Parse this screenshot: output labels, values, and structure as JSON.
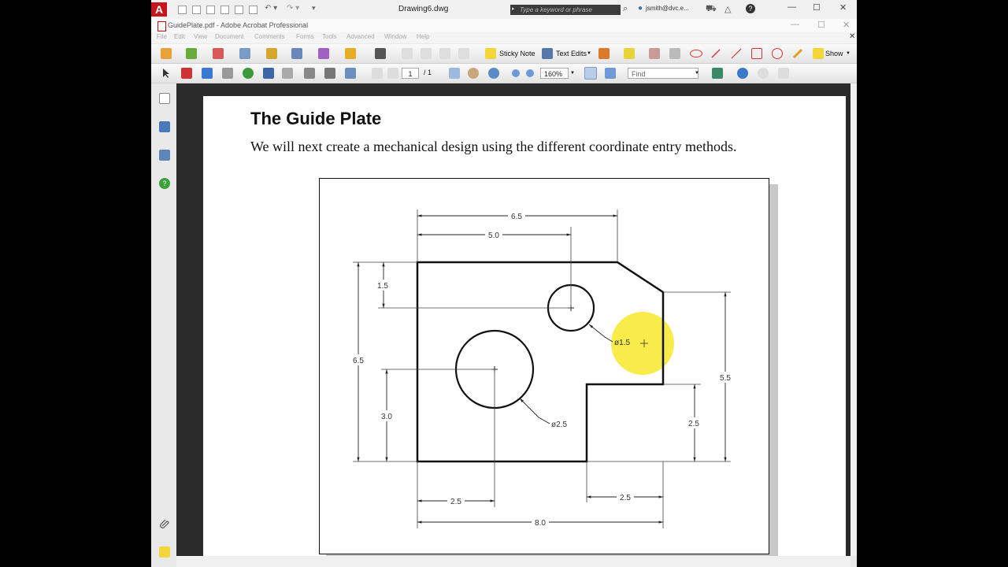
{
  "autocad": {
    "logo": "A",
    "title": "Drawing6.dwg",
    "search_placeholder": "Type a keyword or phrase",
    "user": "jsmith@dvc.e..."
  },
  "acrobat": {
    "window_title": "GuidePlate.pdf - Adobe Acrobat Professional",
    "menu": [
      "File",
      "Edit",
      "View",
      "Document",
      "Comments",
      "Forms",
      "Tools",
      "Advanced",
      "Window",
      "Help"
    ],
    "toolbar1": {
      "sticky_note": "Sticky Note",
      "text_edits": "Text Edits",
      "show": "Show"
    },
    "toolbar2": {
      "page_current": "1",
      "page_total": "/ 1",
      "zoom": "160%",
      "find_placeholder": "Find"
    }
  },
  "document": {
    "heading": "The Guide Plate",
    "paragraph": "We will next create a mechanical design using the different coordinate entry methods.",
    "figure": {
      "dims": {
        "top_overall": "6.5",
        "top_hole": "5.0",
        "left_offset": "1.5",
        "left_overall": "6.5",
        "left_hole": "3.0",
        "small_hole": "ø1.5",
        "large_hole": "ø2.5",
        "right_overall": "5.5",
        "right_step": "2.5",
        "bottom_hole": "2.5",
        "bottom_step": "2.5",
        "bottom_overall": "8.0"
      }
    }
  },
  "colors": {
    "highlight": "#f7ec4a",
    "autocad_red": "#c4161c"
  }
}
